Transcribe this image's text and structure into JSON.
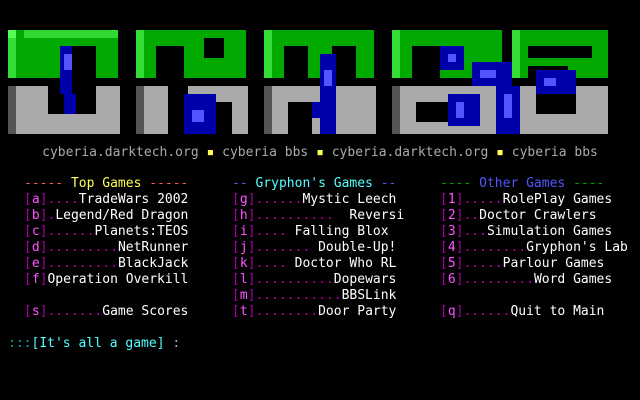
{
  "tagline": {
    "parts": [
      "cyberia.darktech.org",
      "cyberia bbs",
      "cyberia.darktech.org",
      "cyberia bbs"
    ],
    "bullet": "▪"
  },
  "columns": [
    {
      "dash_left": "-----",
      "title": " Top Games ",
      "dash_right": "-----",
      "items": [
        {
          "key": "a",
          "dots": "....",
          "label": "TradeWars 2002"
        },
        {
          "key": "b",
          "dots": ".",
          "label": "Legend/Red Dragon"
        },
        {
          "key": "c",
          "dots": "......",
          "label": "Planets:TEOS"
        },
        {
          "key": "d",
          "dots": ".........",
          "label": "NetRunner"
        },
        {
          "key": "e",
          "dots": ".........",
          "label": "BlackJack"
        },
        {
          "key": "f",
          "dots": "",
          "label": "Operation Overkill"
        }
      ],
      "extra": {
        "key": "s",
        "dots": ".......",
        "label": "Game Scores"
      }
    },
    {
      "dash_left": "--",
      "title": " Gryphon's Games ",
      "dash_right": "--",
      "items": [
        {
          "key": "g",
          "dots": "......",
          "label": "Mystic Leech"
        },
        {
          "key": "h",
          "dots": "..........",
          "label": "  Reversi"
        },
        {
          "key": "i",
          "dots": "....",
          "label": " Falling Blox"
        },
        {
          "key": "j",
          "dots": ".......",
          "label": " Double-Up!"
        },
        {
          "key": "k",
          "dots": "....",
          "label": " Doctor Who RL"
        },
        {
          "key": "l",
          "dots": "..........",
          "label": "Dopewars"
        },
        {
          "key": "m",
          "dots": "...........",
          "label": "BBSLink"
        }
      ],
      "extra": {
        "key": "t",
        "dots": "........",
        "label": "Door Party"
      }
    },
    {
      "dash_left": "----",
      "title": " Other Games ",
      "dash_right": "----",
      "items": [
        {
          "key": "1",
          "dots": ".....",
          "label": "RolePlay Games"
        },
        {
          "key": "2",
          "dots": "..",
          "label": "Doctor Crawlers"
        },
        {
          "key": "3",
          "dots": "...",
          "label": "Simulation Games"
        },
        {
          "key": "4",
          "dots": "........",
          "label": "Gryphon's Lab"
        },
        {
          "key": "5",
          "dots": ".....",
          "label": "Parlour Games"
        },
        {
          "key": "6",
          "dots": ".........",
          "label": "Word Games"
        }
      ],
      "extra": {
        "key": "q",
        "dots": "......",
        "label": "Quit to Main"
      }
    }
  ],
  "prompt": {
    "colons": ":::",
    "open": "[",
    "text": "It's all a game",
    "close": "]",
    "tail": " :"
  },
  "colors": {
    "green": "#00aa00",
    "bright_green": "#55ff55",
    "grey": "#aaaaaa",
    "blue": "#0000aa",
    "bright_blue": "#5555ff",
    "magenta": "#aa00aa",
    "bright_magenta": "#ff55ff",
    "yellow": "#ffff55",
    "cyan": "#55ffff"
  }
}
